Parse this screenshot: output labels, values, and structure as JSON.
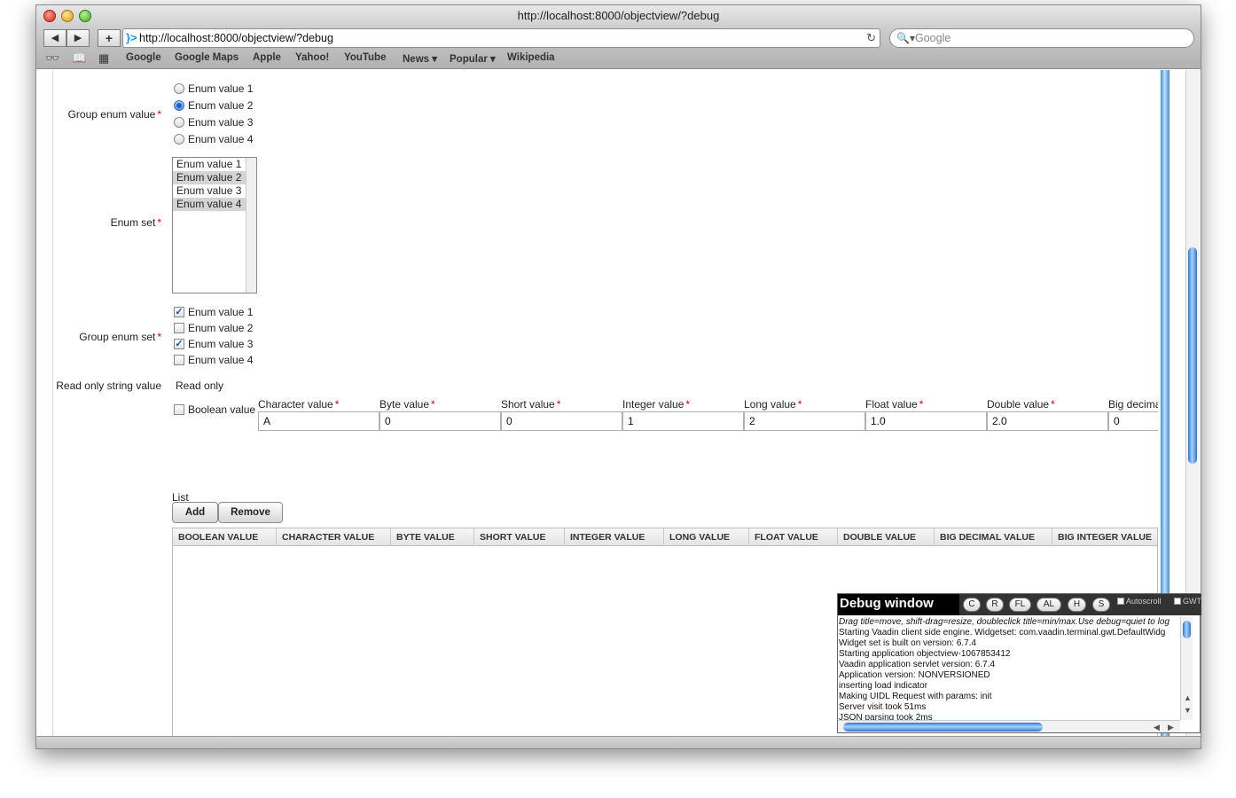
{
  "window": {
    "title": "http://localhost:8000/objectview/?debug"
  },
  "toolbar": {
    "back_icon": "◀",
    "forward_icon": "▶",
    "add_icon": "+",
    "address": "http://localhost:8000/objectview/?debug",
    "reload_icon": "↻",
    "search_placeholder": "Google",
    "search_icon": "🔍▾"
  },
  "bookmarks": {
    "items": [
      "Google",
      "Google Maps",
      "Apple",
      "Yahoo!",
      "YouTube",
      "News ▾",
      "Popular ▾",
      "Wikipedia"
    ],
    "icons": [
      "reader-glasses-icon",
      "book-icon",
      "grid-icon"
    ]
  },
  "form": {
    "group_enum_value": {
      "label": "Group enum value",
      "options": [
        "Enum value 1",
        "Enum value 2",
        "Enum value 3",
        "Enum value 4"
      ],
      "selected": 1
    },
    "enum_set": {
      "label": "Enum set",
      "options": [
        "Enum value 1",
        "Enum value 2",
        "Enum value 3",
        "Enum value 4"
      ]
    },
    "group_enum_set": {
      "label": "Group enum set",
      "options": [
        "Enum value 1",
        "Enum value 2",
        "Enum value 3",
        "Enum value 4"
      ],
      "checked_mark": "✓"
    },
    "read_only": {
      "label": "Read only string value",
      "value": "Read only"
    },
    "boolean_label": "Boolean value",
    "required_mark": "*",
    "fields": [
      {
        "label": "Character value",
        "value": "A"
      },
      {
        "label": "Byte value",
        "value": "0"
      },
      {
        "label": "Short value",
        "value": "0"
      },
      {
        "label": "Integer value",
        "value": "1"
      },
      {
        "label": "Long value",
        "value": "2"
      },
      {
        "label": "Float value",
        "value": "1.0"
      },
      {
        "label": "Double value",
        "value": "2.0"
      },
      {
        "label": "Big decima",
        "value": "0"
      }
    ]
  },
  "list": {
    "label": "List",
    "add_label": "Add",
    "remove_label": "Remove",
    "columns": [
      "BOOLEAN VALUE",
      "CHARACTER VALUE",
      "BYTE VALUE",
      "SHORT VALUE",
      "INTEGER VALUE",
      "LONG VALUE",
      "FLOAT VALUE",
      "DOUBLE VALUE",
      "BIG DECIMAL VALUE",
      "BIG INTEGER VALUE"
    ]
  },
  "debug": {
    "title": "Debug window",
    "buttons": [
      "C",
      "R",
      "FL",
      "AL",
      "H",
      "S"
    ],
    "autoscroll_label": "Autoscroll",
    "gwt_label": "GWT",
    "log": [
      "Drag title=move, shift-drag=resize, doubleclick title=min/max.Use debug=quiet to log",
      "Starting Vaadin client side engine. Widgetset: com.vaadin.terminal.gwt.DefaultWidg",
      "Widget set is built on version: 6.7.4",
      "Starting application objectview-1067853412",
      "Vaadin application servlet version: 6.7.4",
      "Application version: NONVERSIONED",
      "inserting load indicator",
      "Making UIDL Request with params: init",
      "Server visit took 51ms",
      "JSON parsing took 2ms"
    ]
  }
}
